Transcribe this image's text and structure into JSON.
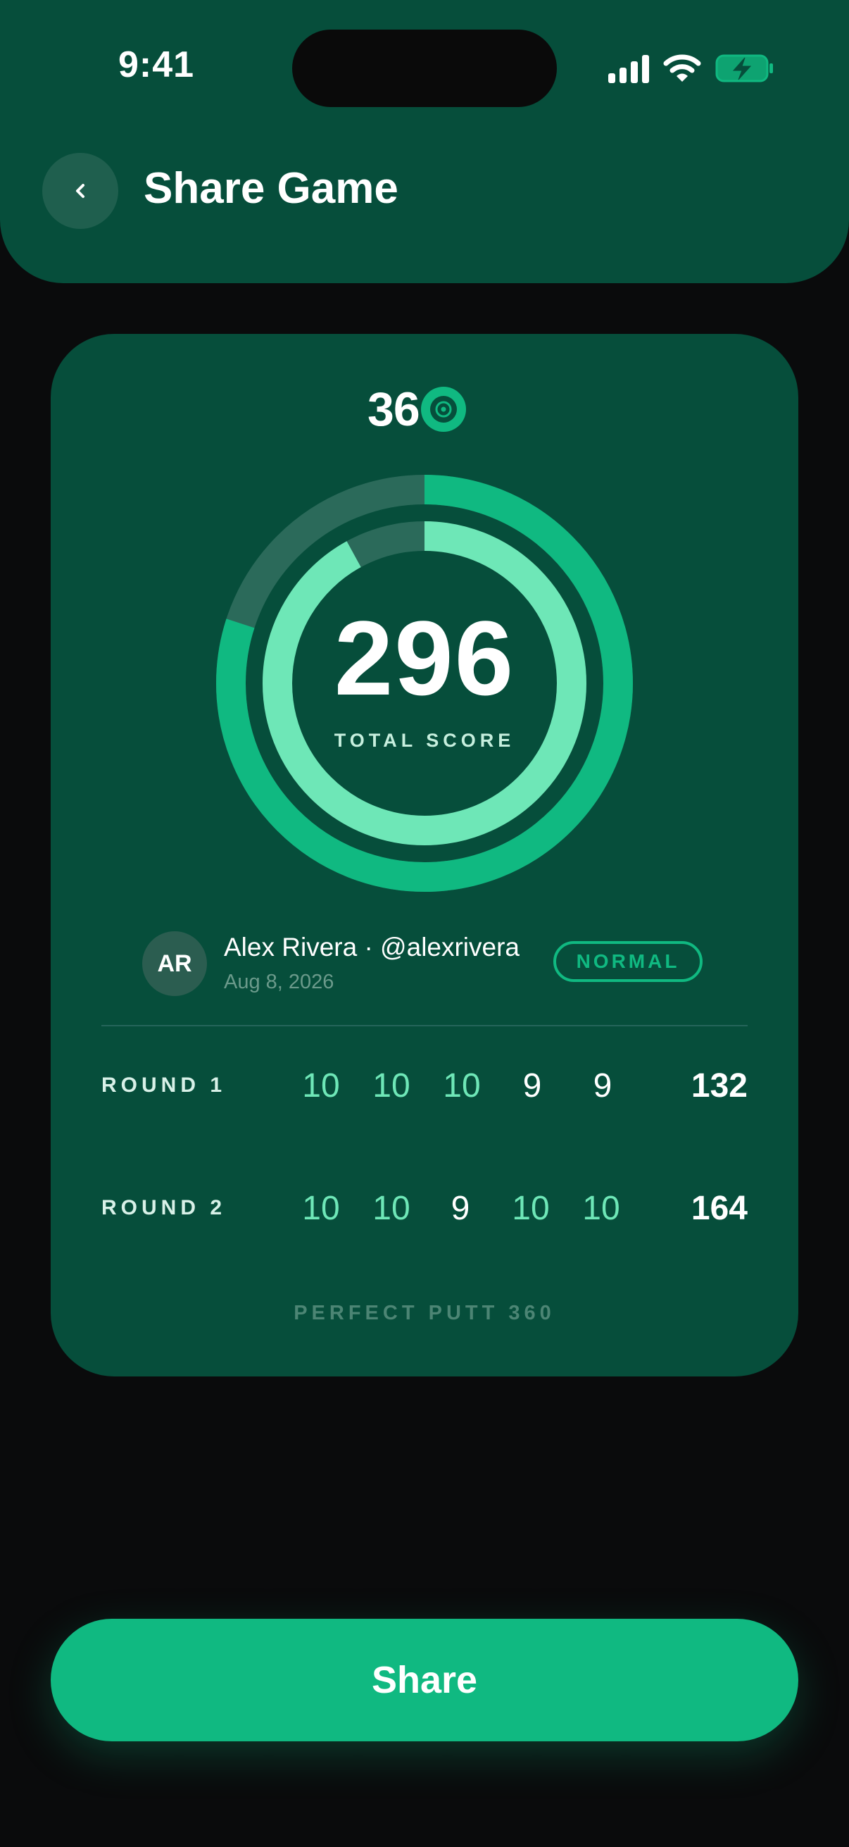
{
  "status_bar": {
    "time": "9:41"
  },
  "header": {
    "title": "Share Game",
    "back_icon": "chevron-left-icon"
  },
  "colors": {
    "header_bg": "#064e3b",
    "card_bg": "#064e3b",
    "accent": "#10b981",
    "accent_light": "#6ee7b7",
    "page_bg": "#0a0b0c"
  },
  "card": {
    "logo_text": "36",
    "logo_icon": "target-icon",
    "total_score": "296",
    "total_label": "TOTAL SCORE",
    "outer_ring_progress": 0.8,
    "inner_ring_progress": 0.92,
    "player": {
      "initials": "AR",
      "name_line": "Alex Rivera · @alexrivera",
      "date": "Aug 8, 2026"
    },
    "mode_badge": "NORMAL",
    "rounds": [
      {
        "label": "ROUND 1",
        "scores": [
          {
            "value": "10",
            "perfect": true
          },
          {
            "value": "10",
            "perfect": true
          },
          {
            "value": "10",
            "perfect": true
          },
          {
            "value": "9",
            "perfect": false
          },
          {
            "value": "9",
            "perfect": false
          }
        ],
        "total": "132"
      },
      {
        "label": "ROUND 2",
        "scores": [
          {
            "value": "10",
            "perfect": true
          },
          {
            "value": "10",
            "perfect": true
          },
          {
            "value": "9",
            "perfect": false
          },
          {
            "value": "10",
            "perfect": true
          },
          {
            "value": "10",
            "perfect": true
          }
        ],
        "total": "164"
      }
    ],
    "footer_brand": "PERFECT PUTT 360"
  },
  "share_button": {
    "label": "Share"
  }
}
